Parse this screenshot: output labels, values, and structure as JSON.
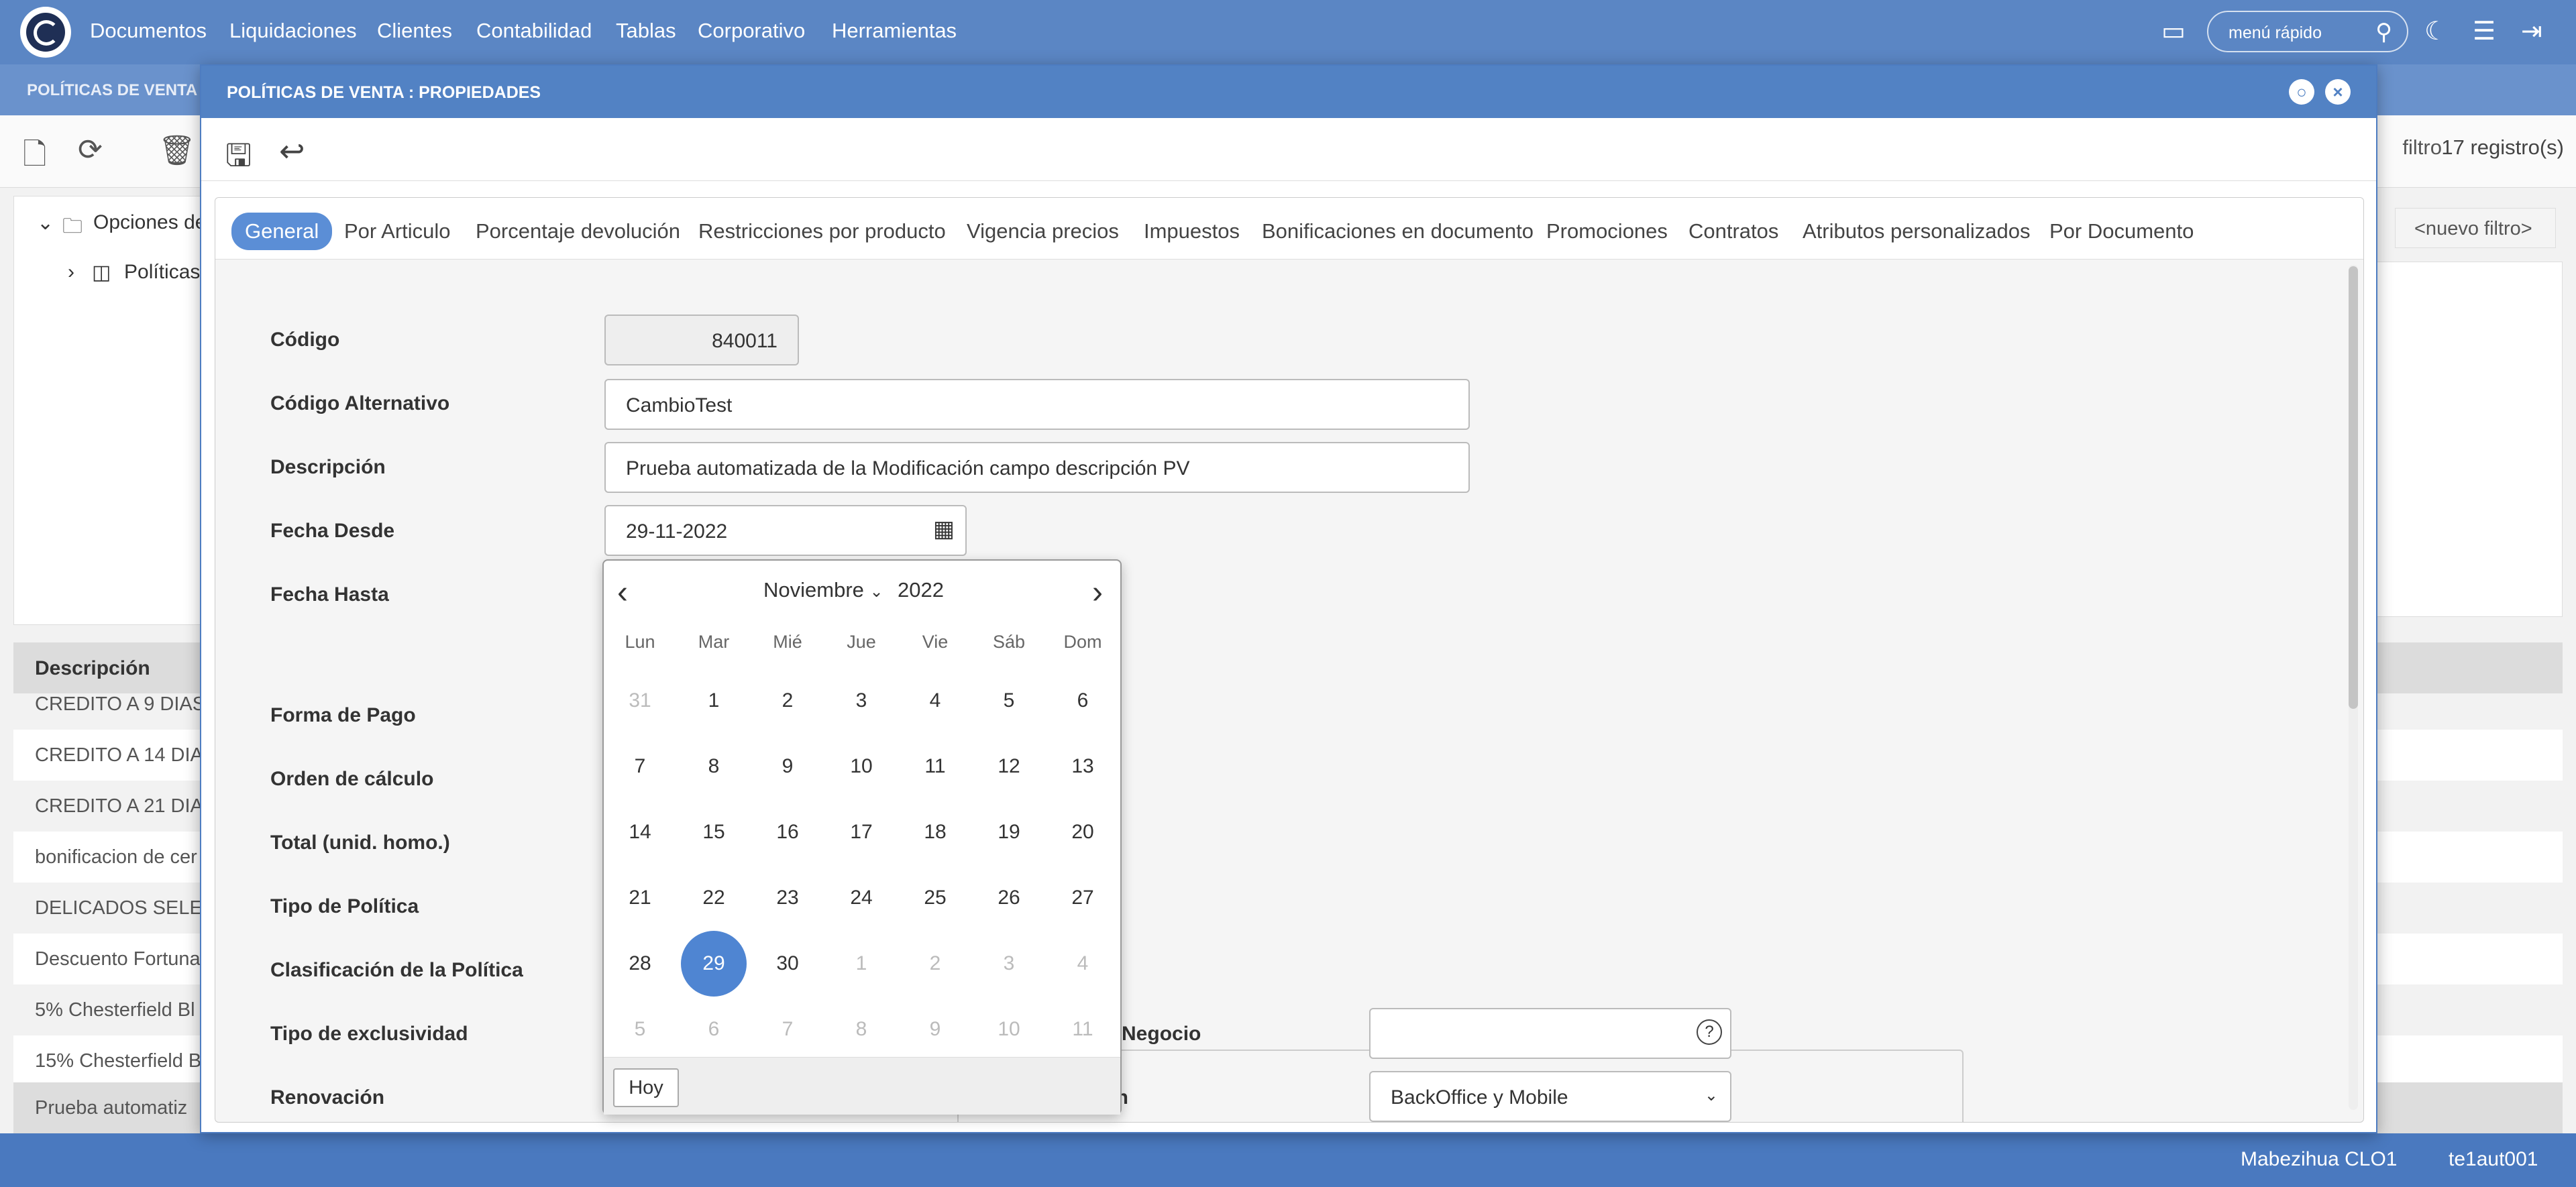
{
  "nav": {
    "menu": [
      "Documentos",
      "Liquidaciones",
      "Clientes",
      "Contabilidad",
      "Tablas",
      "Corporativo",
      "Herramientas"
    ],
    "quick_menu": "menú rápido"
  },
  "background": {
    "subtab": "POLÍTICAS DE VENTA",
    "filter_text": "filtro",
    "records": "17 registro(s)",
    "tree": [
      "Opciones de",
      "Políticas"
    ],
    "new_filter": "<nuevo filtro>",
    "grid_header": "Descripción",
    "rows": [
      "CREDITO A 9 DIAS",
      "CREDITO A 14 DIA",
      "CREDITO A 21 DIA",
      "bonificacion de cer",
      "DELICADOS SELEC",
      "Descuento Fortuna",
      "5% Chesterfield Bl",
      "15% Chesterfield B",
      "Prueba automatiz"
    ]
  },
  "status": {
    "user": "Mabezihua CLO1",
    "instance": "te1aut001"
  },
  "modal": {
    "title": "POLÍTICAS DE VENTA : PROPIEDADES",
    "tabs": [
      "General",
      "Por Articulo",
      "Porcentaje devolución",
      "Restricciones por producto",
      "Vigencia precios",
      "Impuestos",
      "Bonificaciones en documento",
      "Promociones",
      "Contratos",
      "Atributos personalizados",
      "Por Documento"
    ],
    "active_tab": "General",
    "fields": {
      "codigo": {
        "label": "Código",
        "value": "840011"
      },
      "codigo_alt": {
        "label": "Código Alternativo",
        "value": "CambioTest"
      },
      "descripcion": {
        "label": "Descripción",
        "value": "Prueba automatizada de la Modificación campo descripción PV"
      },
      "fecha_desde": {
        "label": "Fecha Desde",
        "value": "29-11-2022"
      },
      "fecha_hasta": {
        "label": "Fecha Hasta"
      },
      "forma_pago": {
        "label": "Forma de Pago"
      },
      "orden": {
        "label": "Orden de cálculo"
      },
      "total": {
        "label": "Total (unid. homo.)"
      },
      "tipo_politica": {
        "label": "Tipo de Política"
      },
      "clasificacion": {
        "label": "Clasificación de la Política"
      },
      "exclusividad": {
        "label": "Tipo de exclusividad"
      },
      "renovacion": {
        "label": "Renovación"
      },
      "negocio": {
        "label": "e Negocio",
        "value": ""
      },
      "origen": {
        "label": "en",
        "value": "BackOffice y Mobile"
      }
    }
  },
  "calendar": {
    "month": "Noviembre",
    "year": "2022",
    "weekdays": [
      "Lun",
      "Mar",
      "Mié",
      "Jue",
      "Vie",
      "Sáb",
      "Dom"
    ],
    "days": [
      "31",
      "1",
      "2",
      "3",
      "4",
      "5",
      "6",
      "7",
      "8",
      "9",
      "10",
      "11",
      "12",
      "13",
      "14",
      "15",
      "16",
      "17",
      "18",
      "19",
      "20",
      "21",
      "22",
      "23",
      "24",
      "25",
      "26",
      "27",
      "28",
      "29",
      "30",
      "1",
      "2",
      "3",
      "4",
      "5",
      "6",
      "7",
      "8",
      "9",
      "10",
      "11"
    ],
    "selected": "29",
    "today_button": "Hoy"
  }
}
